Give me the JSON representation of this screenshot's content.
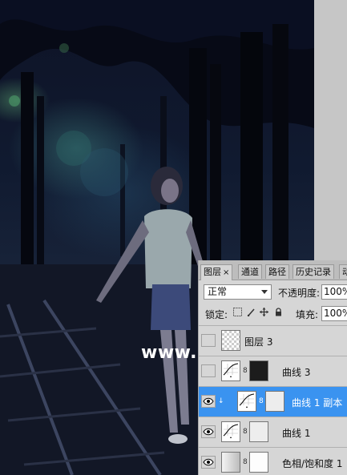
{
  "watermark": "www.68ps.com",
  "layers_panel": {
    "tabs": [
      {
        "label": "图层",
        "close": "×"
      },
      {
        "label": "通道"
      },
      {
        "label": "路径"
      },
      {
        "label": "历史记录"
      },
      {
        "label": "动"
      }
    ],
    "blend_mode": "正常",
    "opacity_label": "不透明度:",
    "opacity_value": "100%",
    "lock_label": "锁定:",
    "lock_icons": [
      "lock-transparent-icon",
      "lock-paint-icon",
      "lock-move-icon",
      "lock-all-icon"
    ],
    "fill_label": "填充:",
    "fill_value": "100%",
    "layers": [
      {
        "name": "图层 3",
        "visible": false,
        "thumb": "transparent",
        "mask": false,
        "selected": false
      },
      {
        "name": "曲线 3",
        "visible": false,
        "thumb": "curves",
        "mask": "dark",
        "selected": false
      },
      {
        "name": "曲线 1 副本",
        "visible": true,
        "thumb": "curves",
        "mask": "light",
        "selected": true
      },
      {
        "name": "曲线 1",
        "visible": true,
        "thumb": "curves",
        "mask": "light",
        "selected": false
      },
      {
        "name": "色相/饱和度 1",
        "visible": true,
        "thumb": "gradient",
        "mask": "white",
        "selected": false
      }
    ]
  }
}
